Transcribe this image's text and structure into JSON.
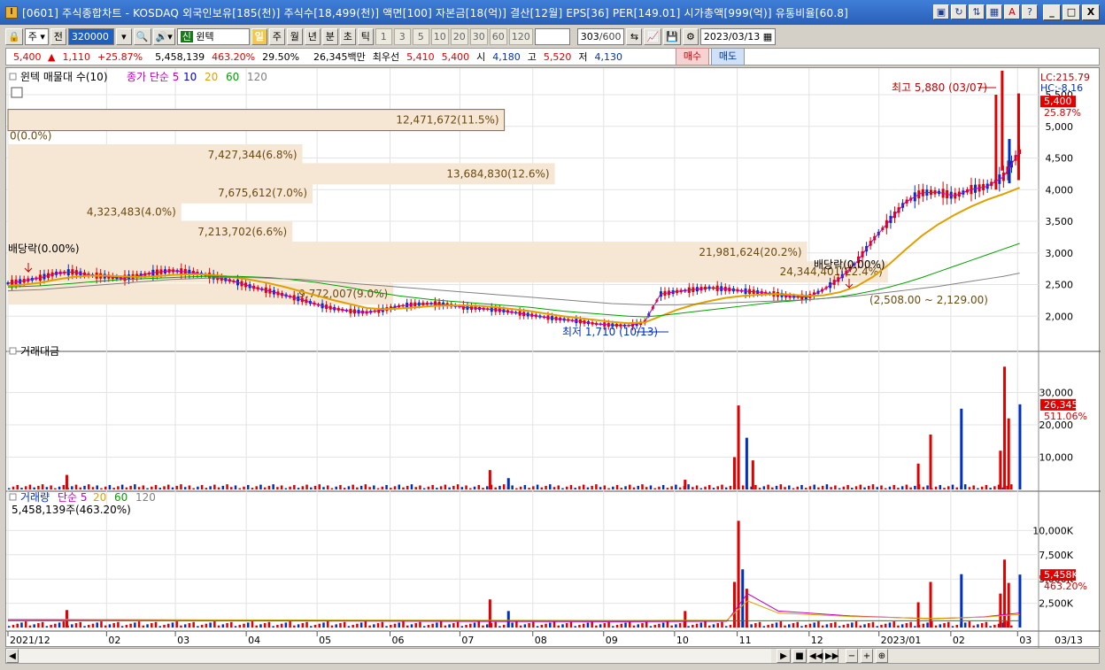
{
  "window": {
    "title": "[0601] 주식종합차트 - KOSDAQ 외국인보유[185(천)] 주식수[18,499(천)] 액면[100] 자본금[18(억)] 결산[12월] EPS[36] PER[149.01] 시가총액[999(억)] 유통비율[60.8]",
    "app_icon": "I",
    "tool_icons": [
      "window-icon",
      "refresh-icon",
      "compare-icon",
      "grid-icon",
      "font-icon",
      "help-icon"
    ],
    "win_buttons": [
      "_",
      "□",
      "X"
    ]
  },
  "toolbar": {
    "market": "주",
    "prev_label": "전",
    "code": "320000",
    "stock_tag": "신",
    "stock_name": "윈텍",
    "periods": [
      "일",
      "주",
      "월",
      "년",
      "분",
      "초",
      "틱"
    ],
    "minute_options": [
      "1",
      "3",
      "5",
      "10",
      "20",
      "30",
      "60",
      "120"
    ],
    "count": "303",
    "count_total": "/600",
    "date": "2023/03/13"
  },
  "quote": {
    "price": "5,400",
    "change": "1,110",
    "change_pct": "+25.87%",
    "volume": "5,458,139",
    "volume_pct": "463.20%",
    "turnover": "29.50%",
    "amount": "26,345백만",
    "best_offer_label": "최우선",
    "best_ask": "5,410",
    "best_bid": "5,400",
    "open_label": "시",
    "open": "4,180",
    "high_label": "고",
    "high": "5,520",
    "low_label": "저",
    "low": "4,130",
    "buy_label": "매수",
    "sell_label": "매도"
  },
  "chart_data": [
    {
      "type": "line",
      "title": "윈텍 매물대 수(10)",
      "legend": [
        {
          "name": "종가 단순 5",
          "color": "#c000c0"
        },
        {
          "name": "10",
          "color": "#0000c0"
        },
        {
          "name": "20",
          "color": "#e0a000"
        },
        {
          "name": "60",
          "color": "#00a000"
        },
        {
          "name": "120",
          "color": "#808080"
        }
      ],
      "y_ticks": [
        "5,500",
        "5,000",
        "4,500",
        "4,000",
        "3,500",
        "3,000",
        "2,500",
        "2,000"
      ],
      "ylim": [
        1500,
        5500
      ],
      "right_labels": {
        "lc": "LC:215.79",
        "hc": "HC:-8.16",
        "price": "5,400",
        "pct": "25.87%"
      },
      "annotations": {
        "high": "최고 5,880 (03/07)",
        "low": "최저 1,710 (10/13)",
        "dividend_1": "배당락(0.00%)",
        "dividend_2": "배당락(0.00%)",
        "range": "(2,508.00 ~ 2,129.00)"
      },
      "volume_profile": [
        {
          "label": "12,471,672(11.5%)",
          "price": 5100
        },
        {
          "label": "0(0.0%)",
          "price": 4850
        },
        {
          "label": "7,427,344(6.8%)",
          "price": 4550
        },
        {
          "label": "13,684,830(12.6%)",
          "price": 4250
        },
        {
          "label": "7,675,612(7.0%)",
          "price": 3950
        },
        {
          "label": "4,323,483(4.0%)",
          "price": 3650
        },
        {
          "label": "7,213,702(6.6%)",
          "price": 3330
        },
        {
          "label": "21,981,624(20.2%)",
          "price": 3010
        },
        {
          "label": "24,344,401(22.4%)",
          "price": 2700
        },
        {
          "label": "9,772,007(9.0%)",
          "price": 2350
        }
      ],
      "ma_points": [
        {
          "name": "5",
          "values": [
            2520,
            2560,
            2610,
            2680,
            2700,
            2650,
            2630,
            2600,
            2640,
            2690,
            2720,
            2700,
            2660,
            2600,
            2540,
            2460,
            2400,
            2330,
            2260,
            2180,
            2120,
            2080,
            2060,
            2100,
            2160,
            2190,
            2200,
            2180,
            2140,
            2120,
            2100,
            2060,
            2020,
            1980,
            1950,
            1920,
            1880,
            1860,
            1850,
            1900,
            2350,
            2390,
            2420,
            2450,
            2430,
            2400,
            2380,
            2350,
            2310,
            2300,
            2420,
            2600,
            2850,
            3200,
            3500,
            3800,
            3950,
            3960,
            3900,
            4000,
            4050,
            4200,
            4600
          ]
        },
        {
          "name": "20",
          "values": [
            2480,
            2500,
            2530,
            2580,
            2620,
            2640,
            2640,
            2630,
            2620,
            2630,
            2650,
            2660,
            2660,
            2640,
            2610,
            2570,
            2520,
            2460,
            2390,
            2320,
            2250,
            2190,
            2130,
            2110,
            2120,
            2140,
            2160,
            2170,
            2170,
            2160,
            2140,
            2110,
            2080,
            2040,
            2000,
            1970,
            1940,
            1910,
            1890,
            1900,
            2000,
            2100,
            2180,
            2240,
            2290,
            2320,
            2340,
            2350,
            2340,
            2320,
            2330,
            2380,
            2470,
            2620,
            2820,
            3050,
            3270,
            3450,
            3600,
            3730,
            3840,
            3930,
            4030
          ]
        },
        {
          "name": "60",
          "values": [
            2460,
            2470,
            2480,
            2500,
            2520,
            2540,
            2560,
            2580,
            2590,
            2600,
            2610,
            2620,
            2630,
            2630,
            2630,
            2620,
            2610,
            2590,
            2560,
            2530,
            2490,
            2450,
            2400,
            2360,
            2320,
            2290,
            2260,
            2240,
            2220,
            2200,
            2180,
            2160,
            2140,
            2110,
            2080,
            2060,
            2040,
            2020,
            2000,
            1990,
            2010,
            2040,
            2070,
            2100,
            2130,
            2160,
            2190,
            2220,
            2240,
            2260,
            2280,
            2310,
            2350,
            2400,
            2460,
            2530,
            2610,
            2700,
            2790,
            2880,
            2970,
            3060,
            3150
          ]
        },
        {
          "name": "120",
          "values": [
            2400,
            2410,
            2420,
            2440,
            2460,
            2480,
            2500,
            2520,
            2540,
            2560,
            2580,
            2590,
            2600,
            2610,
            2610,
            2610,
            2600,
            2590,
            2580,
            2560,
            2540,
            2520,
            2500,
            2480,
            2460,
            2440,
            2420,
            2400,
            2380,
            2360,
            2340,
            2320,
            2300,
            2280,
            2260,
            2240,
            2220,
            2200,
            2190,
            2180,
            2180,
            2180,
            2190,
            2200,
            2210,
            2220,
            2230,
            2240,
            2250,
            2260,
            2280,
            2300,
            2320,
            2350,
            2380,
            2410,
            2440,
            2470,
            2510,
            2550,
            2590,
            2630,
            2680
          ]
        }
      ]
    },
    {
      "type": "bar",
      "title": "거래대금",
      "y_ticks": [
        "30,000",
        "20,000",
        "10,000"
      ],
      "ylim": [
        0,
        40000
      ],
      "right_labels": {
        "value": "26,345",
        "pct": "511.06%"
      },
      "spikes": [
        {
          "pos": 0.056,
          "value": 4500
        },
        {
          "pos": 0.468,
          "value": 6000
        },
        {
          "pos": 0.486,
          "value": 3500
        },
        {
          "pos": 0.658,
          "value": 3000
        },
        {
          "pos": 0.706,
          "value": 10000
        },
        {
          "pos": 0.71,
          "value": 26000
        },
        {
          "pos": 0.718,
          "value": 16000
        },
        {
          "pos": 0.724,
          "value": 9000
        },
        {
          "pos": 0.885,
          "value": 8000
        },
        {
          "pos": 0.897,
          "value": 17000
        },
        {
          "pos": 0.927,
          "value": 25000
        },
        {
          "pos": 0.965,
          "value": 12000
        },
        {
          "pos": 0.969,
          "value": 38000
        },
        {
          "pos": 0.973,
          "value": 22000
        },
        {
          "pos": 0.984,
          "value": 26345
        }
      ]
    },
    {
      "type": "bar",
      "title": "거래량",
      "legend": [
        {
          "name": "단순 5",
          "color": "#c000c0"
        },
        {
          "name": "20",
          "color": "#e0a000"
        },
        {
          "name": "60",
          "color": "#00a000"
        },
        {
          "name": "120",
          "color": "#808080"
        }
      ],
      "subtitle": "5,458,139주(463.20%)",
      "y_ticks": [
        "10,000K",
        "7,500K",
        "5,000K",
        "2,500K"
      ],
      "ylim": [
        0,
        12500
      ],
      "right_labels": {
        "value": "5,458K",
        "pct": "463.20%"
      },
      "spikes": [
        {
          "pos": 0.056,
          "value": 1800
        },
        {
          "pos": 0.468,
          "value": 2900
        },
        {
          "pos": 0.486,
          "value": 1700
        },
        {
          "pos": 0.658,
          "value": 1700
        },
        {
          "pos": 0.706,
          "value": 4700
        },
        {
          "pos": 0.71,
          "value": 11000
        },
        {
          "pos": 0.714,
          "value": 6000
        },
        {
          "pos": 0.718,
          "value": 4000
        },
        {
          "pos": 0.885,
          "value": 2600
        },
        {
          "pos": 0.897,
          "value": 4700
        },
        {
          "pos": 0.927,
          "value": 5500
        },
        {
          "pos": 0.965,
          "value": 3500
        },
        {
          "pos": 0.969,
          "value": 7000
        },
        {
          "pos": 0.973,
          "value": 4600
        },
        {
          "pos": 0.984,
          "value": 5458
        }
      ]
    }
  ],
  "x_axis": {
    "labels": [
      {
        "label": "2021/12",
        "pos": 0.0
      },
      {
        "label": "02",
        "pos": 0.096
      },
      {
        "label": "03",
        "pos": 0.163
      },
      {
        "label": "04",
        "pos": 0.232
      },
      {
        "label": "05",
        "pos": 0.301
      },
      {
        "label": "06",
        "pos": 0.372
      },
      {
        "label": "07",
        "pos": 0.44
      },
      {
        "label": "08",
        "pos": 0.511
      },
      {
        "label": "09",
        "pos": 0.58
      },
      {
        "label": "10",
        "pos": 0.649
      },
      {
        "label": "11",
        "pos": 0.71
      },
      {
        "label": "12",
        "pos": 0.78
      },
      {
        "label": "2023/01",
        "pos": 0.848
      },
      {
        "label": "02",
        "pos": 0.918
      },
      {
        "label": "03",
        "pos": 0.983
      }
    ],
    "end_label": "03/13"
  },
  "scrollbar": {
    "left_arrow": "◀",
    "nav": [
      "▶",
      "■",
      "◀◀",
      "▶▶"
    ],
    "zoom": [
      "−",
      "+",
      "⊕"
    ]
  }
}
